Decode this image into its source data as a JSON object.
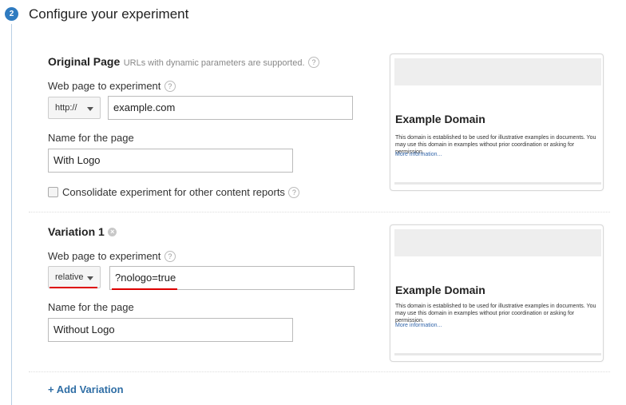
{
  "step": {
    "number": "2",
    "title": "Configure your experiment"
  },
  "original": {
    "title": "Original Page",
    "hint": "URLs with dynamic parameters are supported.",
    "url_label": "Web page to experiment",
    "protocol": "http://",
    "url_value": "example.com",
    "name_label": "Name for the page",
    "name_value": "With Logo",
    "consolidate_label": "Consolidate experiment for other content reports",
    "consolidate_checked": false
  },
  "variation": {
    "title": "Variation 1",
    "url_label": "Web page to experiment",
    "protocol": "relative",
    "url_value": "?nologo=true",
    "name_label": "Name for the page",
    "name_value": "Without Logo"
  },
  "preview": {
    "title": "Example Domain",
    "text": "This domain is established to be used for illustrative examples in documents. You may use this domain in examples without prior coordination or asking for permission.",
    "link": "More information..."
  },
  "add_variation": "+ Add Variation",
  "colors": {
    "accent": "#2f7bc0",
    "link": "#2f6ea5",
    "highlight": "#dd0000"
  }
}
